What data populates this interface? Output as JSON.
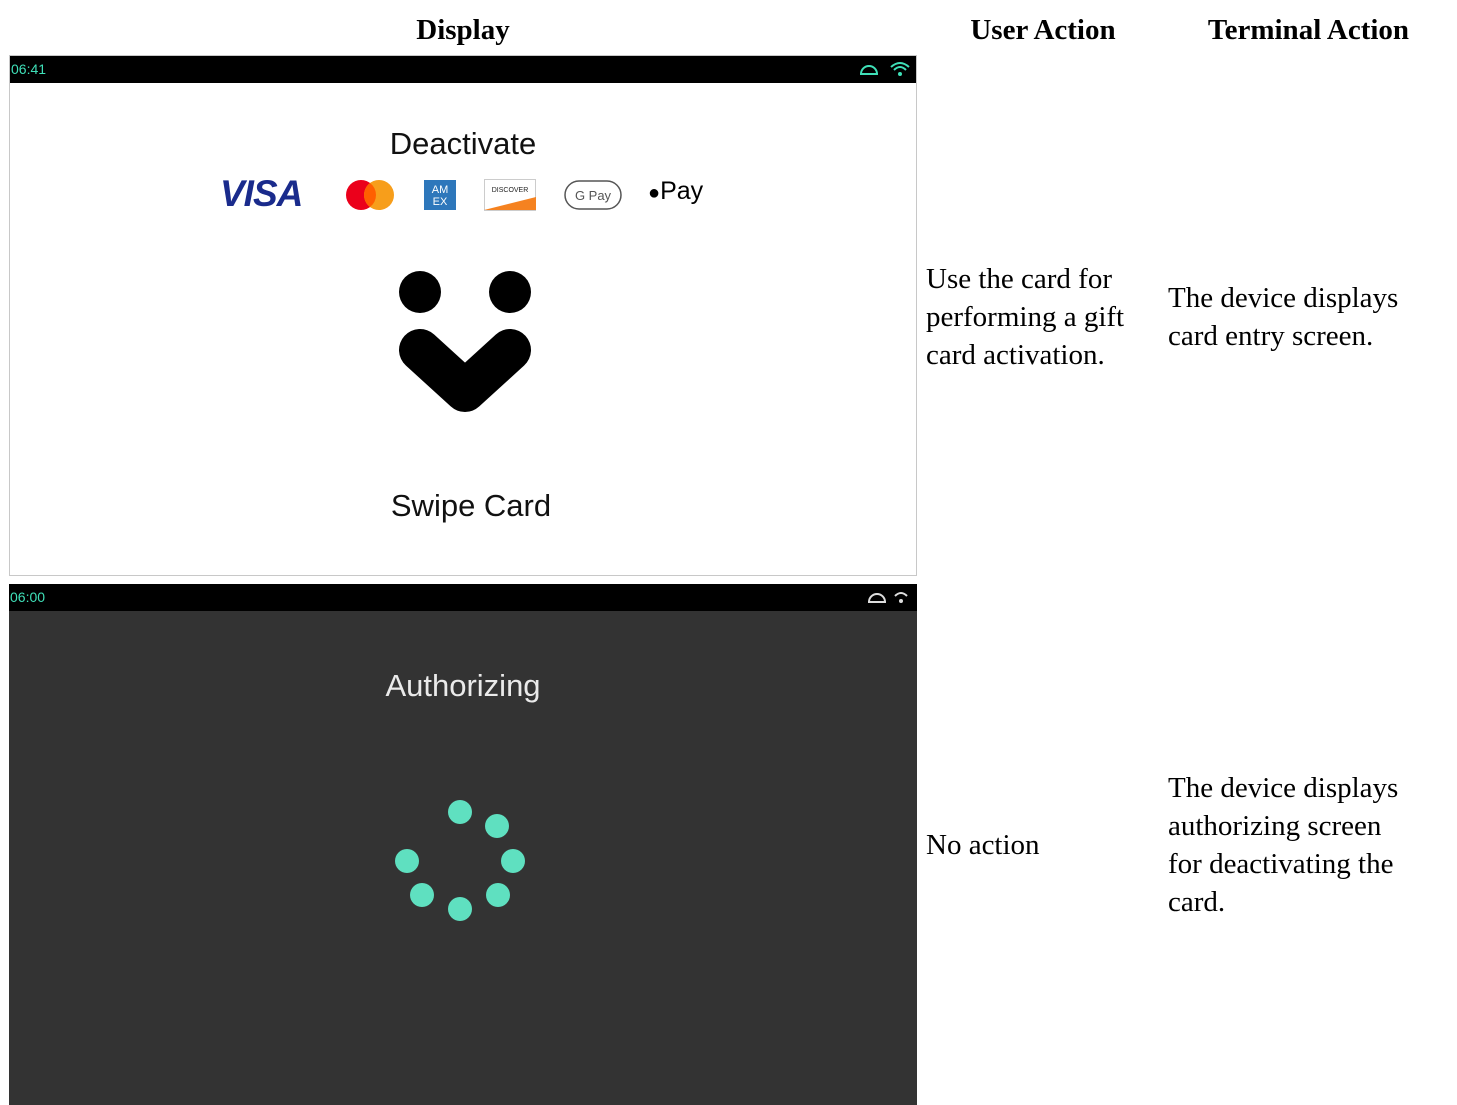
{
  "headers": {
    "display": "Display",
    "user_action": "User Action",
    "terminal_action": "Terminal Action"
  },
  "rows": [
    {
      "screen": {
        "time": "06:41",
        "title": "Deactivate",
        "payment_logos": [
          "VISA",
          "Mastercard",
          "AMEX",
          "DISCOVER",
          "G Pay",
          "Pay"
        ],
        "prompt": "Swipe Card",
        "theme": "light"
      },
      "user_action": "Use the card for performing a gift card activation.",
      "user_action_lines": [
        "Use the card for",
        "performing a gift",
        "card activation."
      ],
      "terminal_action_lines": [
        "The device displays",
        "card entry screen."
      ]
    },
    {
      "screen": {
        "time": "06:00",
        "title": "Authorizing",
        "theme": "dark",
        "spinner_color": "#5fe0c0"
      },
      "user_action_lines": [
        "No action"
      ],
      "terminal_action_lines": [
        "The device displays",
        "authorizing screen",
        "for deactivating the",
        "card."
      ]
    }
  ],
  "colors": {
    "status_bar": "#000000",
    "status_time": "#3fe0b8",
    "dark_screen_bg": "#333333",
    "spinner": "#5fe0c0",
    "visa_blue": "#1a2b8c"
  }
}
